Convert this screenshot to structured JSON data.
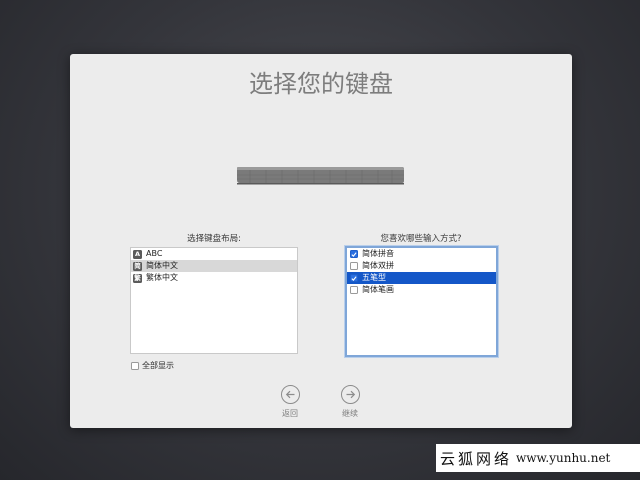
{
  "dialog": {
    "title": "选择您的键盘"
  },
  "layout_section": {
    "label": "选择键盘布局:",
    "items": [
      {
        "badge": "A",
        "label": "ABC",
        "selected": false
      },
      {
        "badge": "简",
        "label": "简体中文",
        "selected": true
      },
      {
        "badge": "繁",
        "label": "繁体中文",
        "selected": false
      }
    ],
    "show_all_label": "全部显示",
    "show_all_checked": false
  },
  "input_section": {
    "label": "您喜欢哪些输入方式?",
    "items": [
      {
        "label": "简体拼音",
        "checked": true,
        "selected": false
      },
      {
        "label": "简体双拼",
        "checked": false,
        "selected": false
      },
      {
        "label": "五笔型",
        "checked": true,
        "selected": true
      },
      {
        "label": "简体笔画",
        "checked": false,
        "selected": false
      }
    ]
  },
  "navigation": {
    "back_label": "返回",
    "back_icon": "arrow-left-circle-icon",
    "continue_label": "继续",
    "continue_icon": "arrow-right-circle-icon"
  },
  "watermark": {
    "text_cn": "云狐网络",
    "url": "www.yunhu.net"
  },
  "colors": {
    "selection_blue": "#1457c8",
    "checkbox_blue": "#2a6fe0",
    "focus_ring": "#7fa6d8"
  }
}
